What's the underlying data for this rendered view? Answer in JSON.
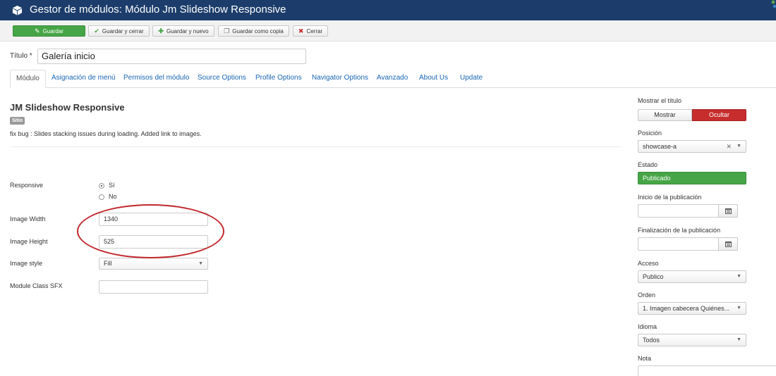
{
  "header": {
    "title": "Gestor de módulos: Módulo Jm Slideshow Responsive",
    "icon": "cube-icon",
    "bg_color": "#1c3d6b"
  },
  "toolbar": {
    "save": "Guardar",
    "save_close": "Guardar y cerrar",
    "save_new": "Guardar y nuevo",
    "save_copy": "Guardar como copia",
    "close": "Cerrar"
  },
  "title_field": {
    "label": "Título *",
    "value": "Galería inicio"
  },
  "tabs": [
    "Módulo",
    "Asignación de menú",
    "Permisos del módulo",
    "Source Options",
    "Profile Options",
    "Navigator Options",
    "Avanzado",
    "About Us",
    "Update"
  ],
  "module": {
    "name": "JM Slideshow Responsive",
    "badge": "Sitio",
    "description": "fix bug : Slides stacking issues during loading. Added link to images."
  },
  "options": {
    "responsive": {
      "label": "Responsive",
      "option_yes": "Sí",
      "option_no": "No",
      "selected": "Sí"
    },
    "image_width": {
      "label": "Image Width",
      "value": "1340"
    },
    "image_height": {
      "label": "Image Height",
      "value": "525"
    },
    "image_style": {
      "label": "Image style",
      "value": "Fill"
    },
    "module_class_sfx": {
      "label": "Module Class SFX",
      "value": ""
    }
  },
  "sidebar": {
    "show_title": {
      "label": "Mostrar el título",
      "show": "Mostrar",
      "hide": "Ocultar",
      "selected": "Ocultar"
    },
    "position": {
      "label": "Posición",
      "value": "showcase-a"
    },
    "status": {
      "label": "Estado",
      "value": "Publicado"
    },
    "publish_up": {
      "label": "Inicio de la publicación",
      "value": ""
    },
    "publish_down": {
      "label": "Finalización de la publicación",
      "value": ""
    },
    "access": {
      "label": "Acceso",
      "value": "Publico"
    },
    "order": {
      "label": "Orden",
      "value": "1. Imagen cabecera Quiénes..."
    },
    "language": {
      "label": "Idioma",
      "value": "Todos"
    },
    "note": {
      "label": "Nota",
      "value": ""
    }
  },
  "colors": {
    "save_green": "#46a546",
    "danger_red": "#c72d2d",
    "link_blue": "#1a66b4",
    "annotation_red": "#c1272d"
  }
}
